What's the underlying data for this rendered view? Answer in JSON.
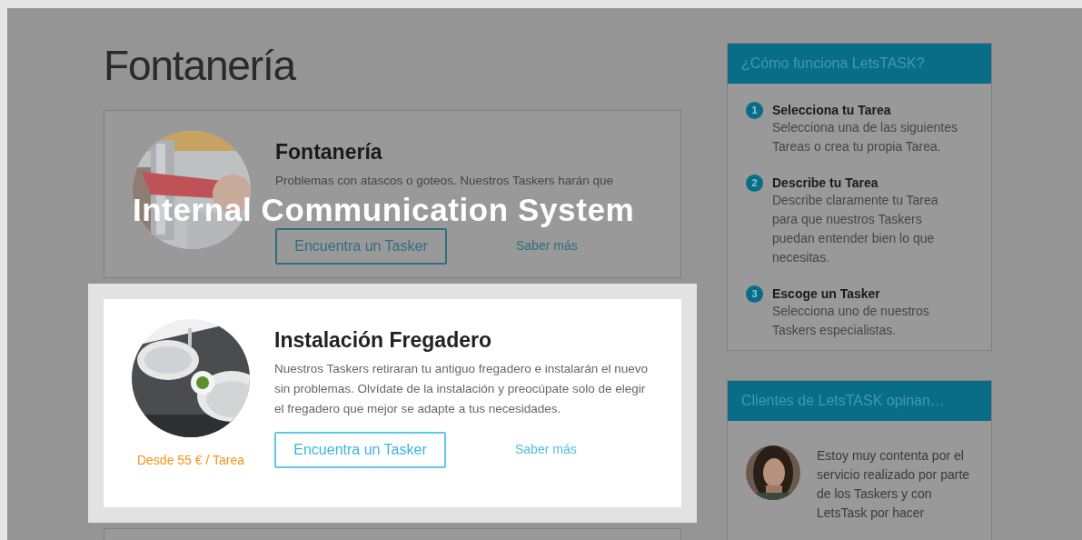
{
  "page_title": "Fontanería",
  "services": [
    {
      "title": "Fontanería",
      "description": [
        "Problemas con atascos o goteos. Nuestros Taskers harán que"
      ],
      "button": "Encuentra un Tasker",
      "link": "Saber más",
      "highlighted": false
    },
    {
      "title": "Instalación Fregadero",
      "description": [
        "Nuestros Taskers retiraran tu antiguo fregadero e instalarán el nuevo sin problemas. Olvídate de la instalación y preocúpate solo de elegir el fregadero que mejor se adapte a tus necesidades."
      ],
      "price": "Desde 55 € / Tarea",
      "button": "Encuentra un Tasker",
      "link": "Saber más",
      "highlighted": true
    },
    {
      "highlighted": false
    }
  ],
  "overlay_caption": "Internal Communication System",
  "sidebar": {
    "how_it_works": {
      "title": "¿Cómo funciona LetsTASK?",
      "steps": [
        {
          "number": "1",
          "title": "Selecciona tu Tarea",
          "text": "Selecciona una de las siguientes Tareas o crea tu propia Tarea."
        },
        {
          "number": "2",
          "title": "Describe tu Tarea",
          "text": "Describe claramente tu Tarea para que nuestros Taskers puedan entender bien lo que necesitas."
        },
        {
          "number": "3",
          "title": "Escoge un Tasker",
          "text": "Selecciona uno de nuestros Taskers especialistas."
        }
      ]
    },
    "testimonials": {
      "title": "Clientes de LetsTASK opinan…",
      "items": [
        {
          "quote": "Estoy muy contenta por el servicio realizado por parte de los Taskers y con LetsTask por hacer"
        }
      ]
    }
  }
}
